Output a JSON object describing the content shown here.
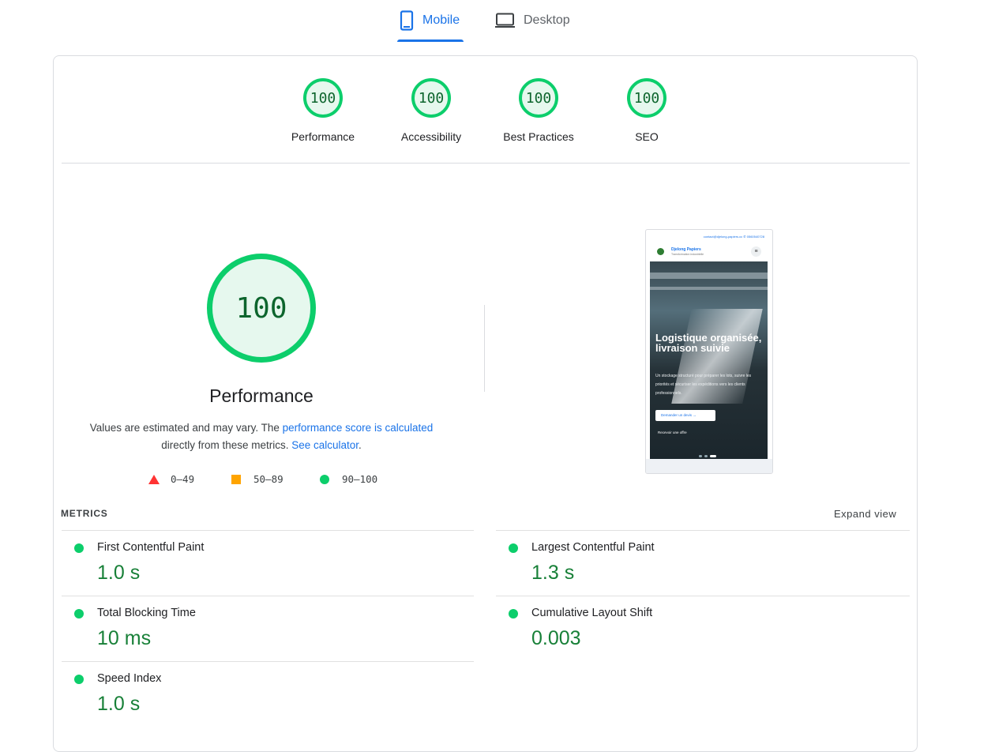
{
  "tabs": {
    "mobile": "Mobile",
    "desktop": "Desktop"
  },
  "scores": [
    {
      "value": "100",
      "label": "Performance"
    },
    {
      "value": "100",
      "label": "Accessibility"
    },
    {
      "value": "100",
      "label": "Best Practices"
    },
    {
      "value": "100",
      "label": "SEO"
    }
  ],
  "performance": {
    "score": "100",
    "title": "Performance",
    "desc_1": "Values are estimated and may vary. The ",
    "desc_link_1": "performance score is calculated",
    "desc_2": "directly from these metrics. ",
    "desc_link_2": "See calculator",
    "desc_3": "."
  },
  "legend": {
    "fail": "0–49",
    "average": "50–89",
    "pass": "90–100"
  },
  "screenshot": {
    "contact_line": "contact@djelong-papiers.cc  ✆ 0560540728",
    "brand": "Djelong Papiers",
    "tagline": "Transformation industrielle",
    "menu_glyph": "≡",
    "headline": "Logistique organisée, livraison suivie",
    "subtext": "Un stockage structuré pour préparer les lots, suivre les priorités et sécuriser les expéditions vers les clients professionnels.",
    "cta_primary": "Demander un devis →",
    "cta_secondary": "Recevoir une offre"
  },
  "metrics": {
    "heading": "METRICS",
    "expand": "Expand view",
    "items": [
      {
        "name": "First Contentful Paint",
        "value": "1.0 s"
      },
      {
        "name": "Largest Contentful Paint",
        "value": "1.3 s"
      },
      {
        "name": "Total Blocking Time",
        "value": "10 ms"
      },
      {
        "name": "Cumulative Layout Shift",
        "value": "0.003"
      },
      {
        "name": "Speed Index",
        "value": "1.0 s"
      }
    ]
  },
  "colors": {
    "pass": "#0cce6b",
    "average": "#ffa400",
    "fail": "#ff3333",
    "link": "#1a73e8",
    "value": "#188038"
  }
}
